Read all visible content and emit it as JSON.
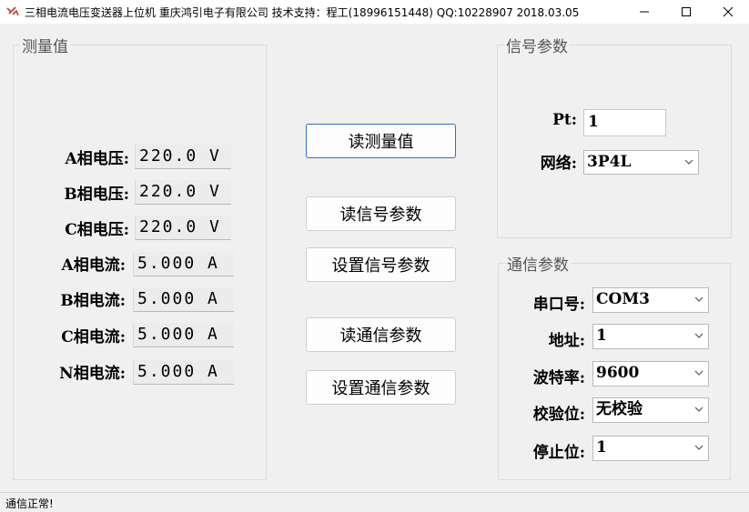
{
  "window": {
    "title": "三相电流电压变送器上位机    重庆鸿引电子有限公司    技术支持：程工(18996151448)    QQ:10228907    2018.03.05",
    "icon": "app-logo-icon"
  },
  "measurement": {
    "group_title": "测量值",
    "rows": [
      {
        "label": "A相电压:",
        "value": "220.0 V"
      },
      {
        "label": "B相电压:",
        "value": "220.0 V"
      },
      {
        "label": "C相电压:",
        "value": "220.0 V"
      },
      {
        "label": "A相电流:",
        "value": "5.000 A"
      },
      {
        "label": "B相电流:",
        "value": "5.000 A"
      },
      {
        "label": "C相电流:",
        "value": "5.000 A"
      },
      {
        "label": "N相电流:",
        "value": "5.000 A"
      }
    ]
  },
  "actions": {
    "read_measure": "读测量值",
    "read_signal": "读信号参数",
    "set_signal": "设置信号参数",
    "read_comm": "读通信参数",
    "set_comm": "设置通信参数"
  },
  "signal": {
    "group_title": "信号参数",
    "pt_label": "Pt:",
    "pt_value": "1",
    "network_label": "网络:",
    "network_value": "3P4L"
  },
  "comm": {
    "group_title": "通信参数",
    "port_label": "串口号:",
    "port_value": "COM3",
    "address_label": "地址:",
    "address_value": "1",
    "baud_label": "波特率:",
    "baud_value": "9600",
    "parity_label": "校验位:",
    "parity_value": "无校验",
    "stop_label": "停止位:",
    "stop_value": "1"
  },
  "status": {
    "text": "通信正常!"
  },
  "colors": {
    "primary_border": "#2f6fc2",
    "background": "#f0f0f0"
  }
}
